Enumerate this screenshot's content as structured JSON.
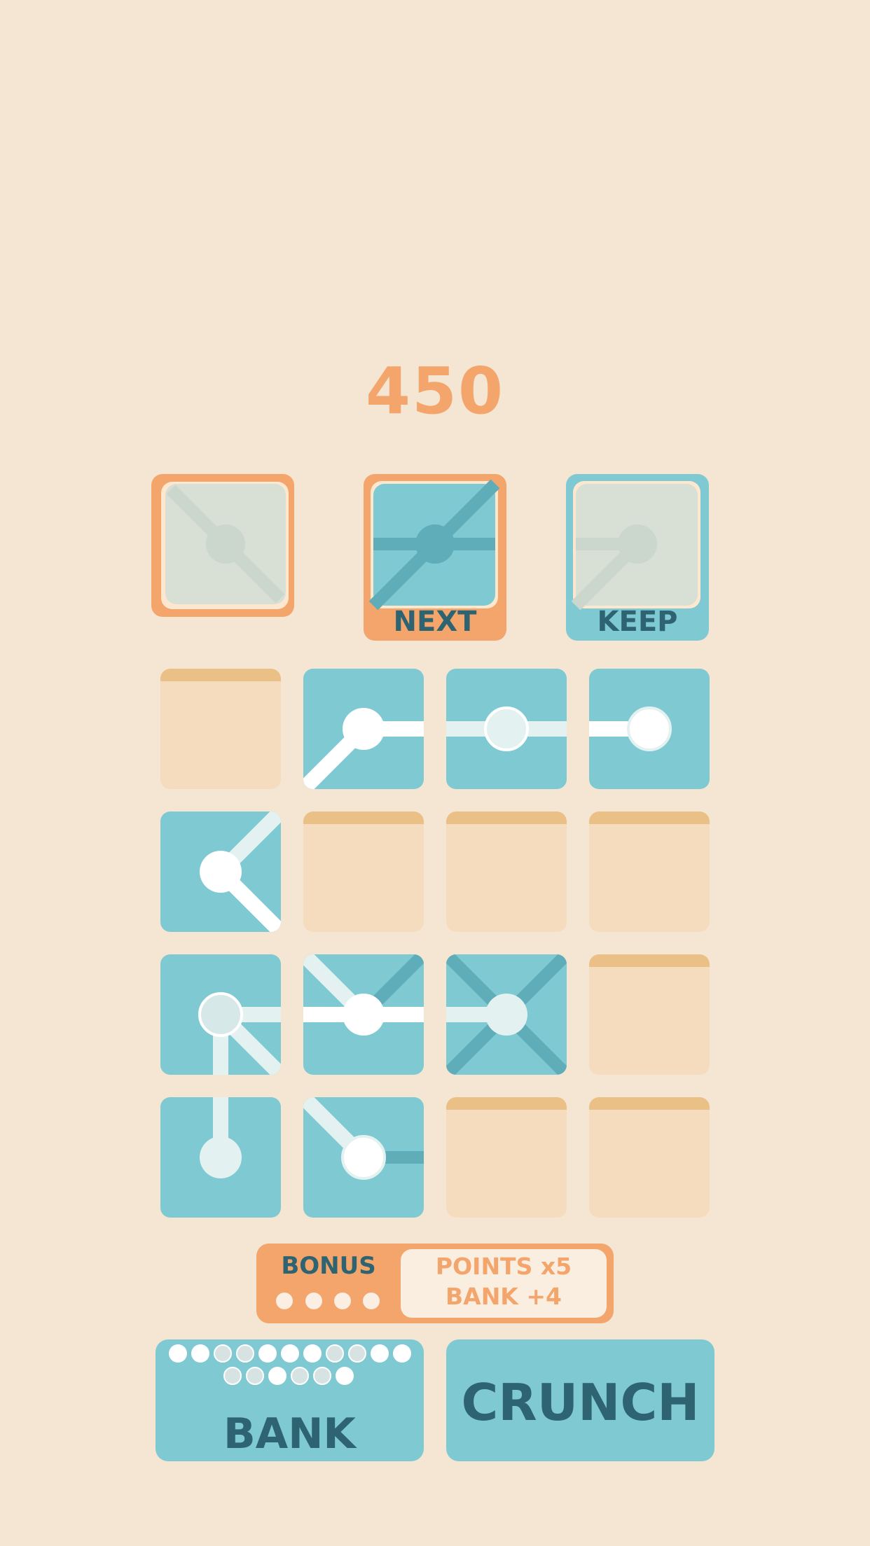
{
  "score": "450",
  "preview": {
    "next_label": "NEXT",
    "keep_label": "KEEP"
  },
  "bonus": {
    "title": "BONUS",
    "line1": "POINTS x5",
    "line2": "BANK +4",
    "dots": 4
  },
  "bank": {
    "label": "BANK",
    "pips_row1": [
      "solid",
      "solid",
      "faint",
      "faint",
      "solid",
      "solid",
      "solid",
      "faint",
      "faint",
      "solid",
      "solid"
    ],
    "pips_row2": [
      "faint",
      "faint",
      "solid",
      "faint",
      "faint",
      "solid"
    ]
  },
  "crunch": {
    "label": "CRUNCH"
  },
  "colors": {
    "background": "#f5e6d3",
    "orange": "#f3a56c",
    "blue": "#7fc9d3",
    "dark_teal": "#2e6471",
    "empty_tile": "#f5dcbe"
  }
}
